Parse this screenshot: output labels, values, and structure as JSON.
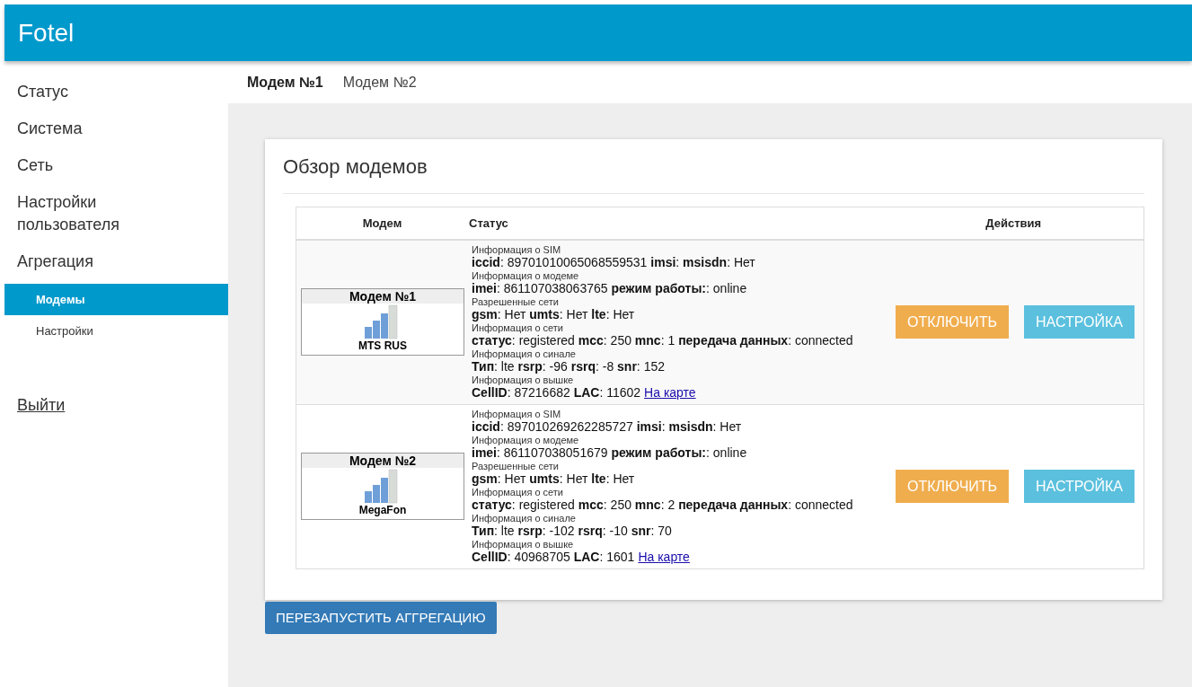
{
  "header": {
    "title": "Fotel"
  },
  "sidebar": {
    "items": [
      {
        "label": "Статус",
        "selected": false
      },
      {
        "label": "Система",
        "selected": false
      },
      {
        "label": "Сеть",
        "selected": false
      },
      {
        "label": "Настройки пользователя",
        "selected": false
      },
      {
        "label": "Агрегация",
        "selected": false,
        "children": [
          {
            "label": "Модемы",
            "selected": true
          },
          {
            "label": "Настройки",
            "selected": false
          }
        ]
      }
    ],
    "logout": "Выйти"
  },
  "tabs": [
    {
      "label": "Модем №1",
      "selected": true
    },
    {
      "label": "Модем №2",
      "selected": false
    }
  ],
  "card": {
    "title": "Обзор модемов",
    "table": {
      "columns": [
        "Модем",
        "Статус",
        "Действия"
      ],
      "rows": [
        {
          "modem": {
            "name": "Модем №1",
            "operator": "MTS RUS"
          },
          "status": [
            {
              "label": "Информация о SIM",
              "line": "**iccid**: 89701010065068559531 **imsi**: **msisdn**: Нет"
            },
            {
              "label": "Информация о модеме",
              "line": "**imei**: 861107038063765 **режим работы:**: online"
            },
            {
              "label": "Разрешенные сети",
              "line": "**gsm**: Нет **umts**: Нет **lte**: Нет"
            },
            {
              "label": "Информация о сети",
              "line": "**статус**: registered **mcc**: 250 **mnc**: 1 **передача данных**: connected"
            },
            {
              "label": "Информация о синале",
              "line": "**Тип**: lte **rsrp**: -96 **rsrq**: -8 **snr**: 152"
            },
            {
              "label": "Информация о вышке",
              "line": "**CellID**: 87216682 **LAC**: 11602",
              "link": "На карте"
            }
          ],
          "actions": [
            {
              "label": "ОТКЛЮЧИТЬ",
              "kind": "warning"
            },
            {
              "label": "НАСТРОЙКА",
              "kind": "info"
            }
          ]
        },
        {
          "modem": {
            "name": "Модем №2",
            "operator": "MegaFon"
          },
          "status": [
            {
              "label": "Информация о SIM",
              "line": "**iccid**: 897010269262285727 **imsi**: **msisdn**: Нет"
            },
            {
              "label": "Информация о модеме",
              "line": "**imei**: 861107038051679 **режим работы:**: online"
            },
            {
              "label": "Разрешенные сети",
              "line": "**gsm**: Нет **umts**: Нет **lte**: Нет"
            },
            {
              "label": "Информация о сети",
              "line": "**статус**: registered **mcc**: 250 **mnc**: 2 **передача данных**: connected"
            },
            {
              "label": "Информация о синале",
              "line": "**Тип**: lte **rsrp**: -102 **rsrq**: -10 **snr**: 70"
            },
            {
              "label": "Информация о вышке",
              "line": "**CellID**: 40968705 **LAC**: 1601",
              "link": "На карте"
            }
          ],
          "actions": [
            {
              "label": "ОТКЛЮЧИТЬ",
              "kind": "warning"
            },
            {
              "label": "НАСТРОЙКА",
              "kind": "info"
            }
          ]
        }
      ]
    }
  },
  "restart_button": "ПЕРЕЗАПУСТИТЬ АГГРЕГАЦИЮ"
}
